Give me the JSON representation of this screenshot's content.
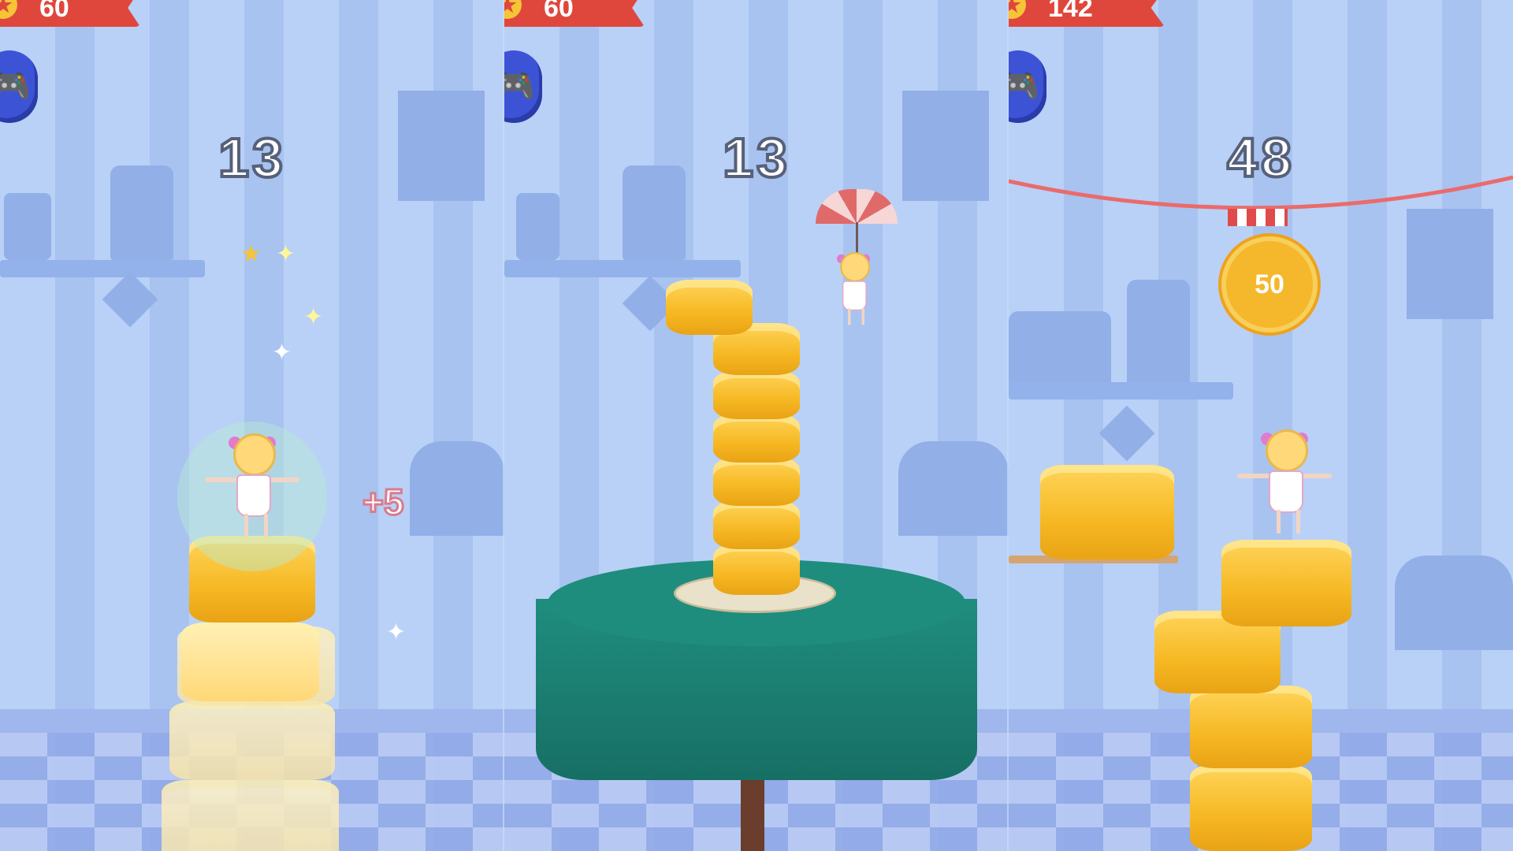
{
  "panels": [
    {
      "coins": "60",
      "score": "13",
      "bonus": "+5"
    },
    {
      "coins": "60",
      "score": "13"
    },
    {
      "coins": "142",
      "score": "48",
      "medal": "50"
    }
  ],
  "icons": {
    "coin": "star-coin-icon",
    "controller": "gamepad-icon"
  },
  "colors": {
    "badge": "#e0473c",
    "button": "#3d53d6",
    "cake": "#f6b823",
    "tablecloth": "#1f8d7e"
  }
}
